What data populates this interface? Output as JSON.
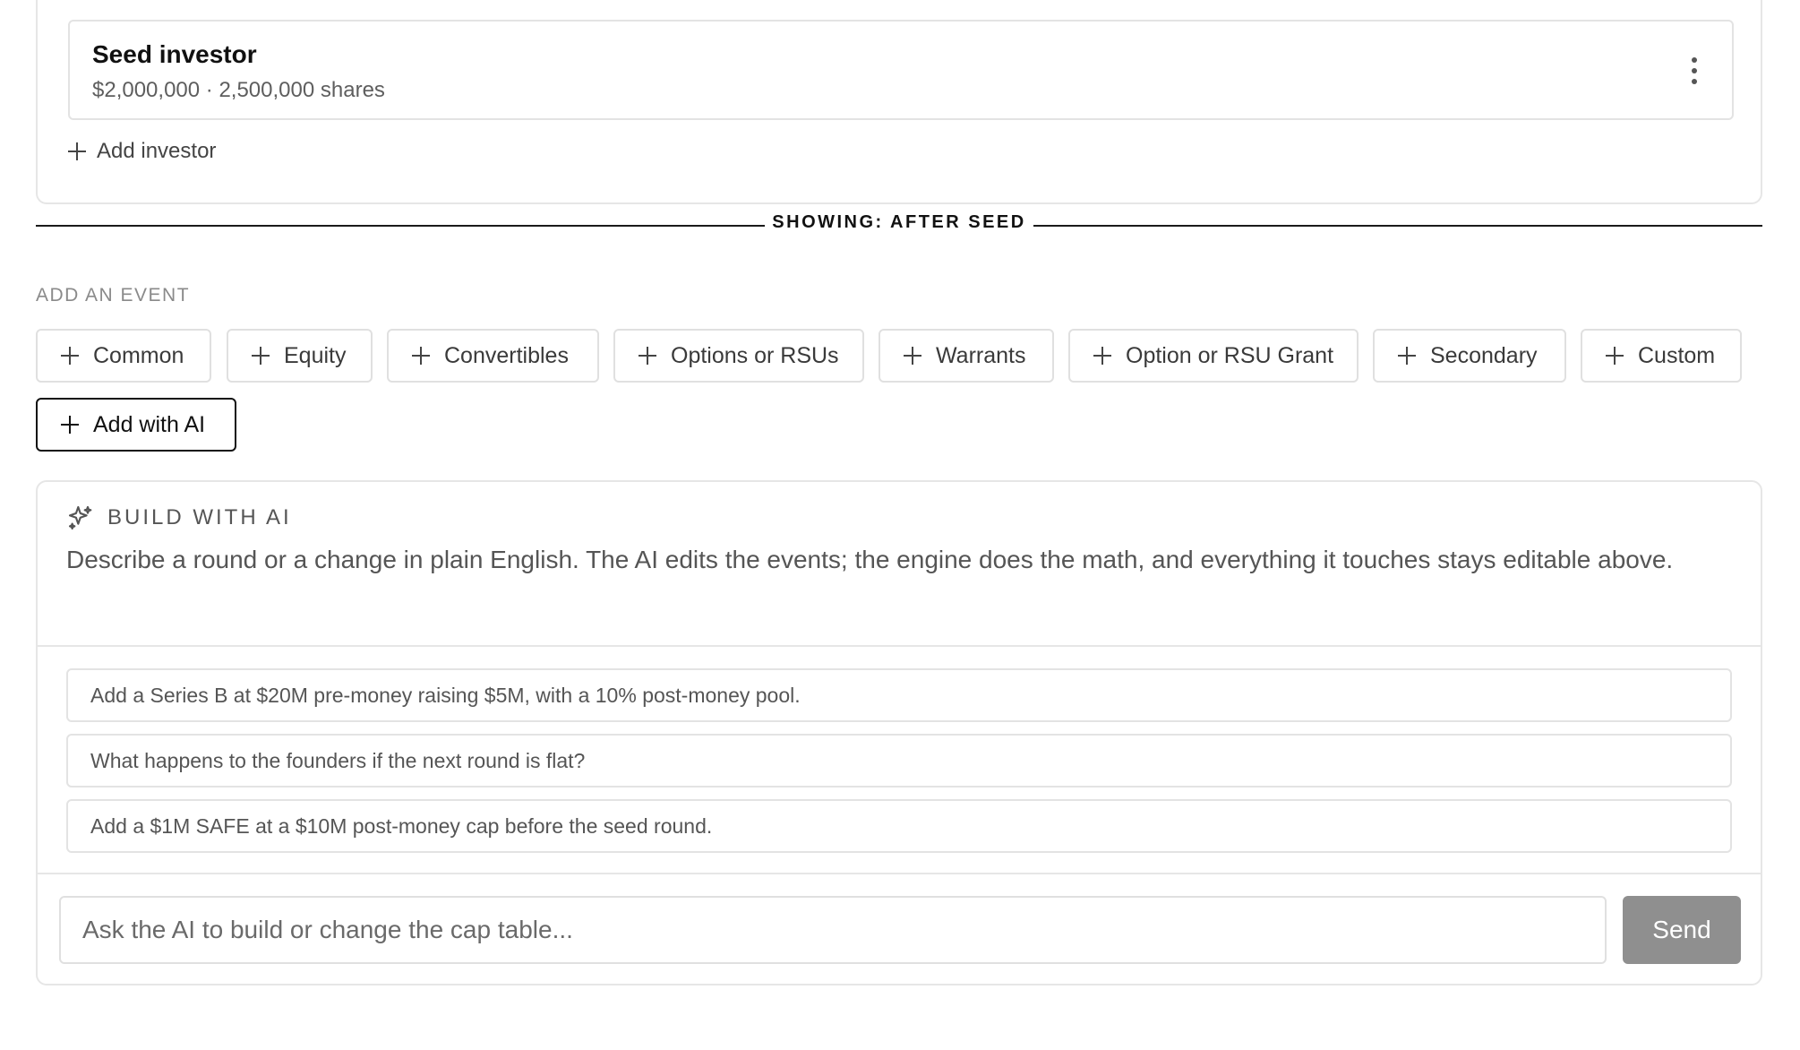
{
  "investor_section": {
    "investor": {
      "name": "Seed investor",
      "meta": "$2,000,000 · 2,500,000 shares"
    },
    "add_investor_label": "Add investor"
  },
  "divider": {
    "label": "SHOWING: AFTER SEED"
  },
  "add_event": {
    "label": "ADD AN EVENT",
    "buttons": [
      "Common",
      "Equity",
      "Convertibles",
      "Options or RSUs",
      "Warrants",
      "Option or RSU Grant",
      "Secondary",
      "Custom"
    ],
    "ai_button_label": "Add with AI"
  },
  "ai_panel": {
    "title": "BUILD WITH AI",
    "description": "Describe a round or a change in plain English. The AI edits the events; the engine does the math, and everything it touches stays editable above.",
    "suggestions": [
      "Add a Series B at $20M pre-money raising $5M, with a 10% post-money pool.",
      "What happens to the founders if the next round is flat?",
      "Add a $1M SAFE at a $10M post-money cap before the seed round."
    ],
    "input_placeholder": "Ask the AI to build or change the cap table...",
    "send_label": "Send"
  }
}
